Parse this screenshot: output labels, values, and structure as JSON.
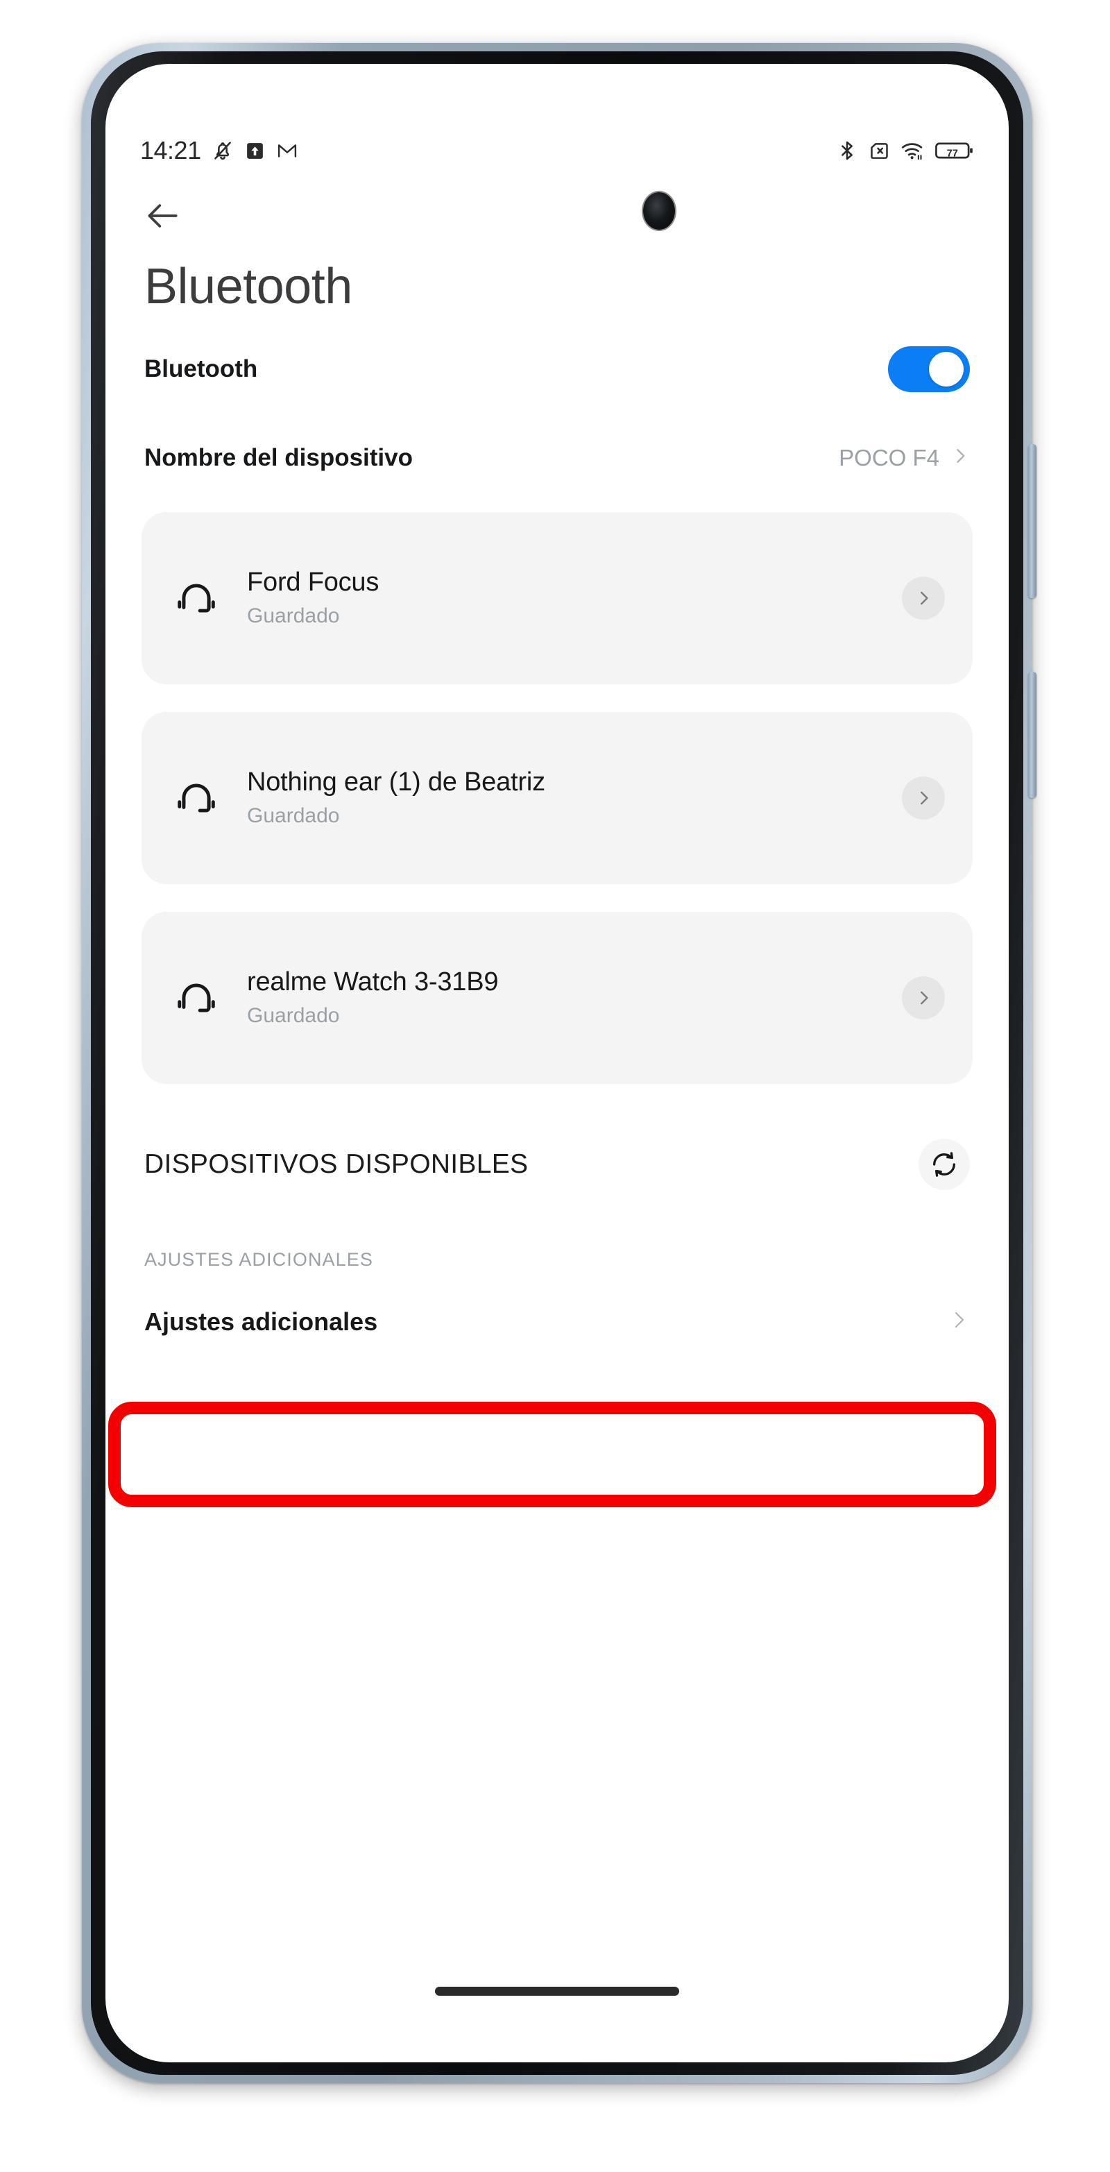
{
  "status_bar": {
    "time": "14:21",
    "left_icons": [
      "silent-mode-icon",
      "upload-icon",
      "gmail-icon"
    ],
    "right_icons": [
      "bluetooth-icon",
      "no-sim-icon",
      "wifi-icon",
      "battery-icon"
    ],
    "battery_level": "77"
  },
  "header": {
    "back_icon": "back-arrow-icon",
    "title": "Bluetooth"
  },
  "bluetooth_toggle": {
    "label": "Bluetooth",
    "state": "on",
    "accent_color": "#0b7ef5"
  },
  "device_name": {
    "label": "Nombre del dispositivo",
    "value": "POCO F4",
    "chevron": "chevron-right-icon"
  },
  "paired_devices": [
    {
      "icon": "headset-icon",
      "name": "Ford Focus",
      "status": "Guardado",
      "chevron": "chevron-right-icon"
    },
    {
      "icon": "headset-icon",
      "name": "Nothing ear (1) de Beatriz",
      "status": "Guardado",
      "chevron": "chevron-right-icon"
    },
    {
      "icon": "headset-icon",
      "name": "realme Watch 3-31B9",
      "status": "Guardado",
      "chevron": "chevron-right-icon"
    }
  ],
  "available_section": {
    "label": "DISPOSITIVOS DISPONIBLES",
    "refresh_icon": "refresh-icon"
  },
  "additional_section": {
    "header": "AJUSTES ADICIONALES",
    "row_label": "Ajustes adicionales",
    "chevron": "chevron-right-icon"
  },
  "annotation": {
    "type": "highlight-rectangle",
    "color": "#f40000",
    "target": "DISPOSITIVOS DISPONIBLES"
  },
  "colors": {
    "card_background": "#f4f4f4",
    "screen_background": "#ffffff",
    "muted_text": "#9aa0a6",
    "primary_text": "#17181a"
  }
}
